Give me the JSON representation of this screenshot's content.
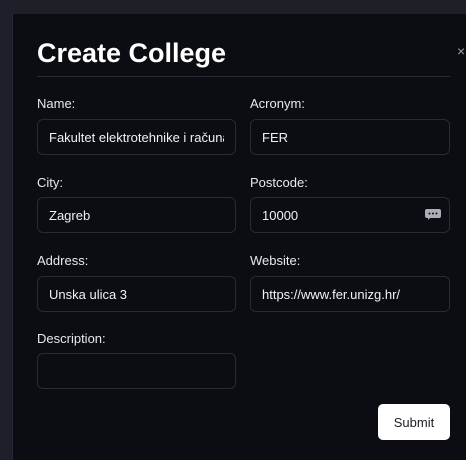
{
  "modal": {
    "title": "Create College",
    "close_glyph": "×",
    "submit_label": "Submit"
  },
  "fields": {
    "name": {
      "label": "Name:",
      "value": "Fakultet elektrotehnike i računar"
    },
    "acronym": {
      "label": "Acronym:",
      "value": "FER"
    },
    "city": {
      "label": "City:",
      "value": "Zagreb"
    },
    "postcode": {
      "label": "Postcode:",
      "value": "10000"
    },
    "address": {
      "label": "Address:",
      "value": "Unska ulica 3"
    },
    "website": {
      "label": "Website:",
      "value": "https://www.fer.unizg.hr/"
    },
    "description": {
      "label": "Description:",
      "value": ""
    }
  },
  "icons": {
    "postcode_field_icon": "chat-bubble-icon"
  },
  "colors": {
    "modal_background": "#0b0d12",
    "backdrop": "#1d2029",
    "submit_background": "#ffffff"
  }
}
